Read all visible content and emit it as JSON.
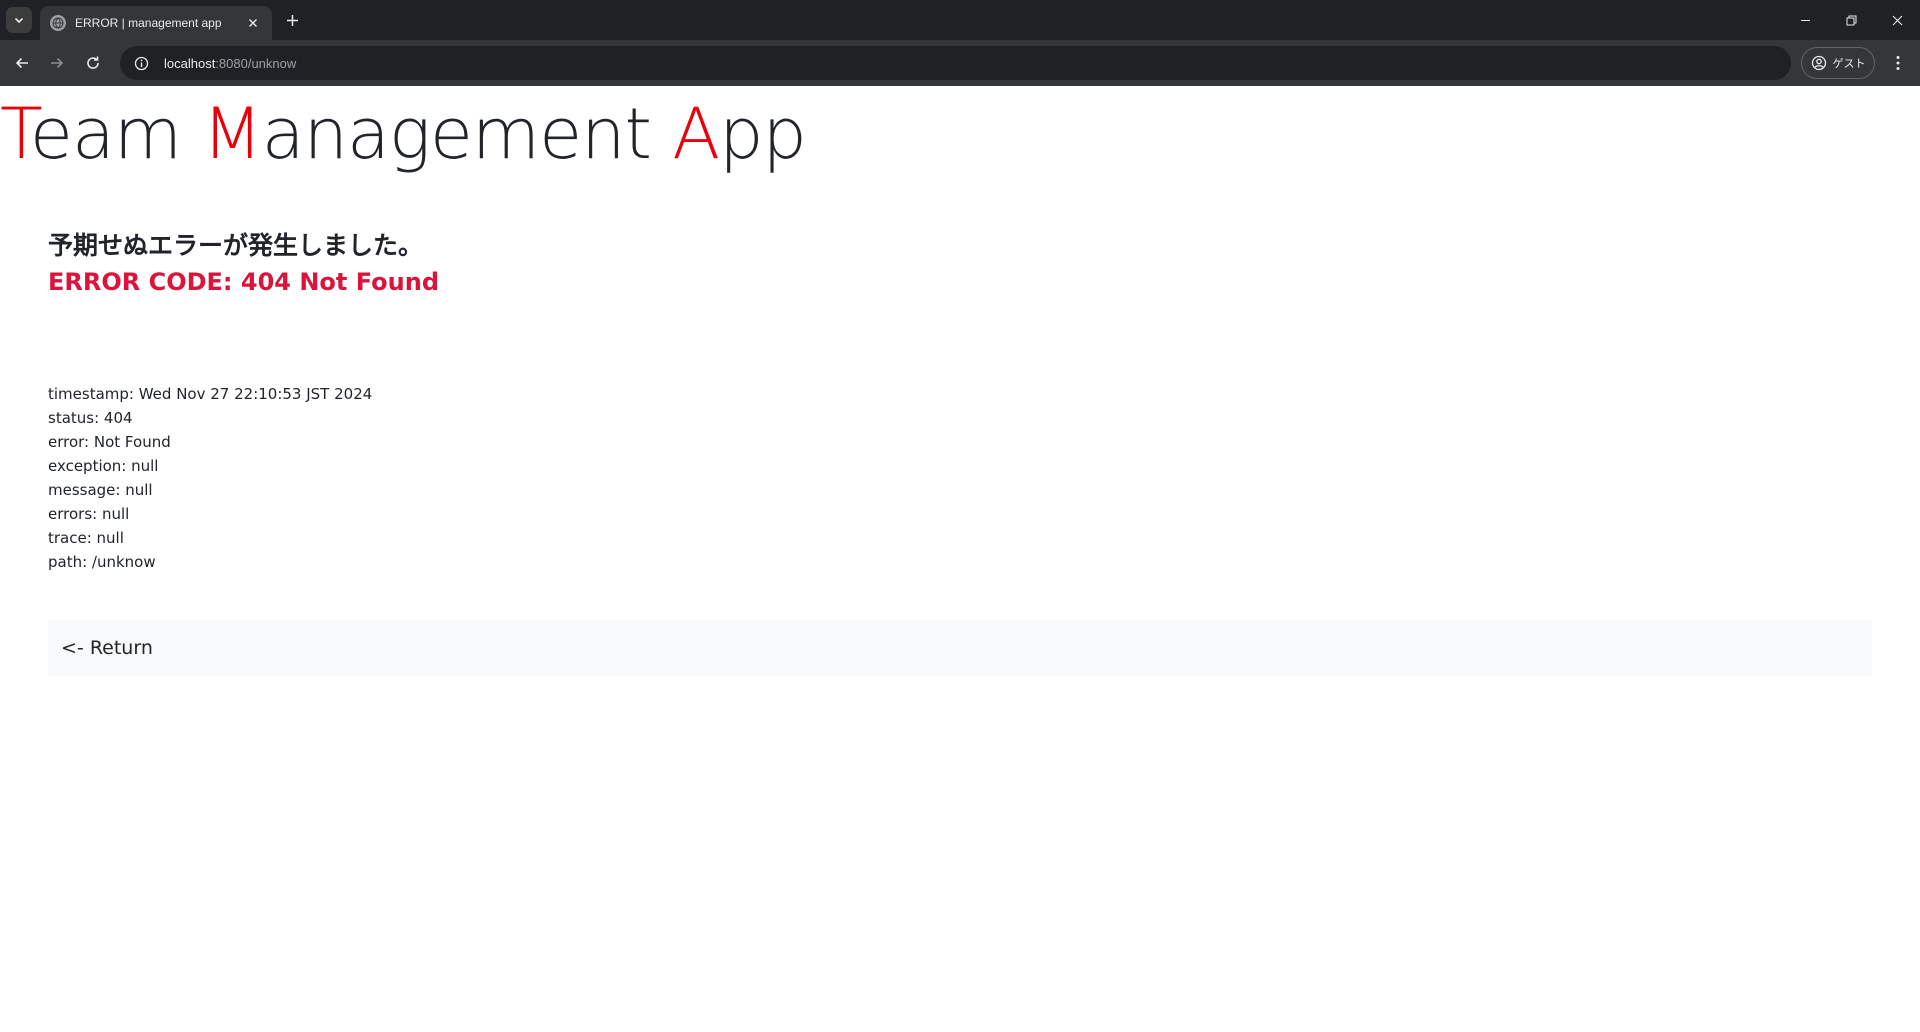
{
  "browser": {
    "tab_title": "ERROR | management app",
    "url_host": "localhost",
    "url_rest": ":8080/unknow",
    "profile_label": "ゲスト"
  },
  "brand": {
    "segments": [
      {
        "accent": "T",
        "rest": "eam "
      },
      {
        "accent": "M",
        "rest": "anagement "
      },
      {
        "accent": "A",
        "rest": "pp"
      }
    ],
    "accent_color": "#e8000b"
  },
  "error": {
    "title": "予期せぬエラーが発生しました。",
    "code": "ERROR CODE: 404 Not Found",
    "code_color": "#dc143c"
  },
  "details": [
    "timestamp: Wed Nov 27 22:10:53 JST 2024",
    "status: 404",
    "error: Not Found",
    "exception: null",
    "message: null",
    "errors: null",
    "trace: null",
    "path: /unknow"
  ],
  "return_link": "<- Return"
}
